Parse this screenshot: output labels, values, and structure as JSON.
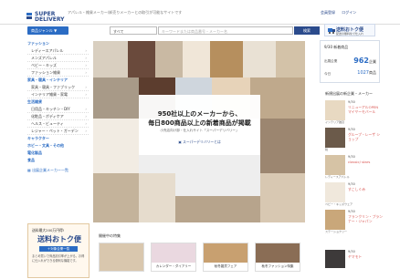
{
  "header": {
    "tagline": "アパレル・雑貨メーカー/卸売りメーカーとの取引が可能なサイトです",
    "logo_top": "SUPER",
    "logo_bottom": "DELIVERY",
    "links": [
      "会員登録",
      "ログイン"
    ]
  },
  "search": {
    "category_button": "商品ジャンル ▼",
    "scope_select": "すべて",
    "placeholder": "キーワードまたは商品番号・メーカー名",
    "button": "検索"
  },
  "top_banner": {
    "title": "送料おトク便",
    "sub": "配送の無料化で仕入れ"
  },
  "sidebar": {
    "groups": [
      {
        "head": "ファッション",
        "items": [
          "レディースアパレル",
          "メンズアパレル",
          "ベビー・キッズ",
          "ファッション雑貨"
        ]
      },
      {
        "head": "家具・寝具・インテリア",
        "items": [
          "家具・寝具・ファブリック",
          "インテリア雑貨・家電"
        ]
      },
      {
        "head": "生活雑貨",
        "items": [
          "日用品・キッチン・DIY",
          "化粧品・ボディケア",
          "ヘルス・ビューティ",
          "レジャー・ペット・ガーデン"
        ]
      },
      {
        "head": "キャラクター",
        "items": []
      },
      {
        "head": "ホビー・文具・その他",
        "items": []
      },
      {
        "head": "電化製品",
        "items": []
      },
      {
        "head": "食品",
        "items": []
      }
    ],
    "footer_link": "出展企業メーカー一覧"
  },
  "hero": {
    "line1": "950社以上のメーカーから、",
    "line2": "毎日800商品以上の新着商品が掲載",
    "line3": "小売店向け卸・仕入れサイト「スーパーデリバリー」",
    "link": "スーパーデリバリーとは"
  },
  "stats": {
    "title": "9/30 新着商品",
    "row1_label": "出展企業",
    "row1_value": "962",
    "row1_unit": "企業",
    "row2_label": "今日",
    "row2_value": "1027",
    "row2_unit": "商品"
  },
  "new_makers": {
    "title": "新規出展の新企業・メーカー",
    "items": [
      {
        "date": "9/30",
        "name": "リニューアルOPEN マイヤーモバール",
        "cat": "インテリア雑貨"
      },
      {
        "date": "9/30",
        "name": "グループ・レーザ ショップ",
        "cat": "靴"
      },
      {
        "date": "9/30",
        "name": "classic/ stars",
        "cat": "レディースアパレル"
      },
      {
        "date": "9/30",
        "name": "すこしぐみ",
        "cat": "ベビー・キッズウェア"
      },
      {
        "date": "9/30",
        "name": "フランクリン・プランナー・ジャパン",
        "cat": "ステーショナリー"
      },
      {
        "date": "9/30",
        "name": "ヤマモト",
        "cat": ""
      }
    ]
  },
  "promo": {
    "line1": "送料最大200万円得!",
    "logo": "送料おトク便",
    "button": "＋対象企業一覧",
    "desc": "まとめ買いで商品割引率が上がる。お得に仕入れができる便利な機能です。"
  },
  "shops": {
    "title": "開催中の特集",
    "captions": [
      "",
      "カレンダー・ダイアリー",
      "秋冬雑貨フェア",
      "秋冬ファッション特集"
    ]
  }
}
